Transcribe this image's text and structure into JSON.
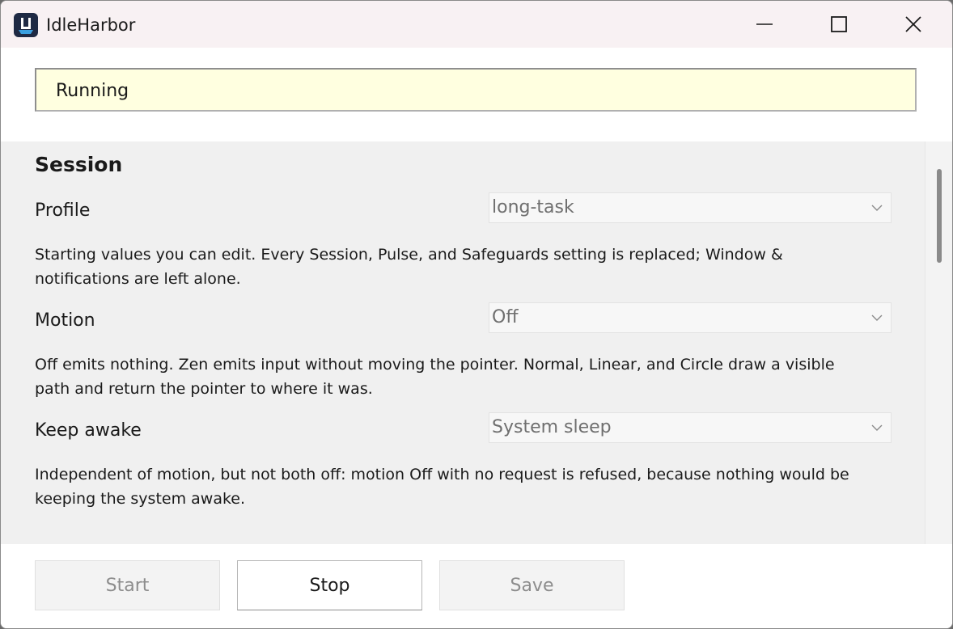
{
  "window": {
    "title": "IdleHarbor",
    "app_icon": "harbor-app-icon",
    "controls": [
      "minimize-icon",
      "maximize-icon",
      "close-icon"
    ]
  },
  "status": {
    "text": "Running",
    "background": "#ffffe0"
  },
  "session": {
    "title": "Session",
    "fields": [
      {
        "label": "Profile",
        "value": "long-task",
        "description": "Starting values you can edit. Every Session, Pulse, and Safeguards setting is replaced; Window & notifications are left alone."
      },
      {
        "label": "Motion",
        "value": "Off",
        "description": "Off emits nothing. Zen emits input without moving the pointer. Normal, Linear, and Circle draw a visible path and return the pointer to where it was."
      },
      {
        "label": "Keep awake",
        "value": "System sleep",
        "description": "Independent of motion, but not both off: motion Off with no request is refused, because nothing would be keeping the system awake."
      }
    ]
  },
  "buttons": {
    "start": "Start",
    "stop": "Stop",
    "save": "Save"
  },
  "colors": {
    "accent": "#1e88c8",
    "content_bg": "#f0f0f0",
    "titlebar_bg": "#f8f1f3"
  }
}
